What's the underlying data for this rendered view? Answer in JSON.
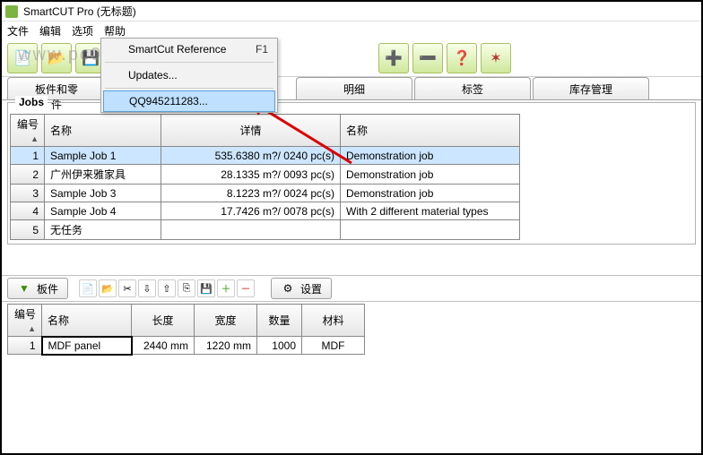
{
  "title": "SmartCUT Pro (无标题)",
  "menu": {
    "file": "文件",
    "edit": "编辑",
    "view": "选项",
    "help": "帮助"
  },
  "watermark": "www.pc0359.cn",
  "help_menu": {
    "reference": "SmartCut Reference",
    "reference_key": "F1",
    "updates": "Updates...",
    "qq": "QQ945211283..."
  },
  "tabs": {
    "panels": "板件和零件",
    "detail": "明细",
    "labels": "标签",
    "stock": "库存管理"
  },
  "jobs": {
    "label": "Jobs",
    "headers": {
      "no": "编号",
      "name": "名称",
      "detail": "详情",
      "name2": "名称"
    },
    "rows": [
      {
        "no": "1",
        "name": "Sample Job 1",
        "detail": "535.6380 m?/ 0240 pc(s)",
        "name2": "Demonstration job"
      },
      {
        "no": "2",
        "name": "广州伊来雅家具",
        "detail": "28.1335 m?/ 0093 pc(s)",
        "name2": "Demonstration job"
      },
      {
        "no": "3",
        "name": "Sample Job 3",
        "detail": "8.1223 m?/ 0024 pc(s)",
        "name2": "Demonstration job"
      },
      {
        "no": "4",
        "name": "Sample Job 4",
        "detail": "17.7426 m?/ 0078 pc(s)",
        "name2": "With 2 different material types"
      },
      {
        "no": "5",
        "name": "无任务",
        "detail": "",
        "name2": ""
      }
    ]
  },
  "panel_toolbar": {
    "panel_btn": "板件",
    "settings_btn": "设置"
  },
  "parts": {
    "headers": {
      "no": "编号",
      "name": "名称",
      "length": "长度",
      "width": "宽度",
      "qty": "数量",
      "material": "材料"
    },
    "rows": [
      {
        "no": "1",
        "name": "MDF panel",
        "length": "2440 mm",
        "width": "1220 mm",
        "qty": "1000",
        "material": "MDF"
      }
    ]
  }
}
